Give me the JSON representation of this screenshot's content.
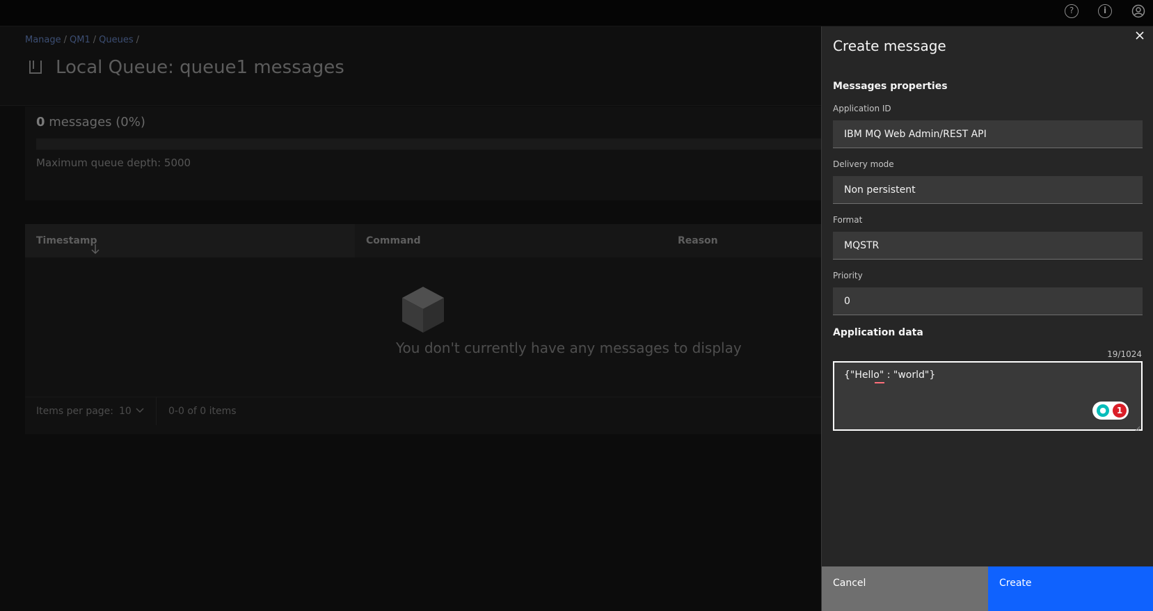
{
  "topbar": {
    "help_glyph": "?",
    "info_glyph": "i"
  },
  "breadcrumb": {
    "items": [
      "Manage",
      "QM1",
      "Queues"
    ],
    "sep": "/"
  },
  "page": {
    "title": "Local Queue: queue1 messages"
  },
  "stats": {
    "count": "0",
    "count_suffix": " messages (0%)",
    "depth": "Maximum queue depth: 5000"
  },
  "table": {
    "columns": [
      "Timestamp",
      "Command",
      "Reason"
    ],
    "empty_text": "You don't currently have any messages to display",
    "items_per_page_label": "Items per page:",
    "items_per_page_value": "10",
    "range_text": "0-0 of 0 items"
  },
  "panel": {
    "title": "Create message",
    "section_properties": "Messages properties",
    "application_id_label": "Application ID",
    "application_id_value": "IBM MQ Web Admin/REST API",
    "delivery_mode_label": "Delivery mode",
    "delivery_mode_value": "Non persistent",
    "format_label": "Format",
    "format_value": "MQSTR",
    "priority_label": "Priority",
    "priority_value": "0",
    "section_data": "Application data",
    "char_counter": "19/1024",
    "application_data": "{\"Hello\" : \"world\"}",
    "badge_count": "1",
    "cancel_label": "Cancel",
    "create_label": "Create"
  },
  "colors": {
    "primary": "#0f62fe",
    "secondary": "#6f6f6f",
    "panel_bg": "#262626",
    "field_bg": "#393939",
    "error": "#da1e28"
  }
}
